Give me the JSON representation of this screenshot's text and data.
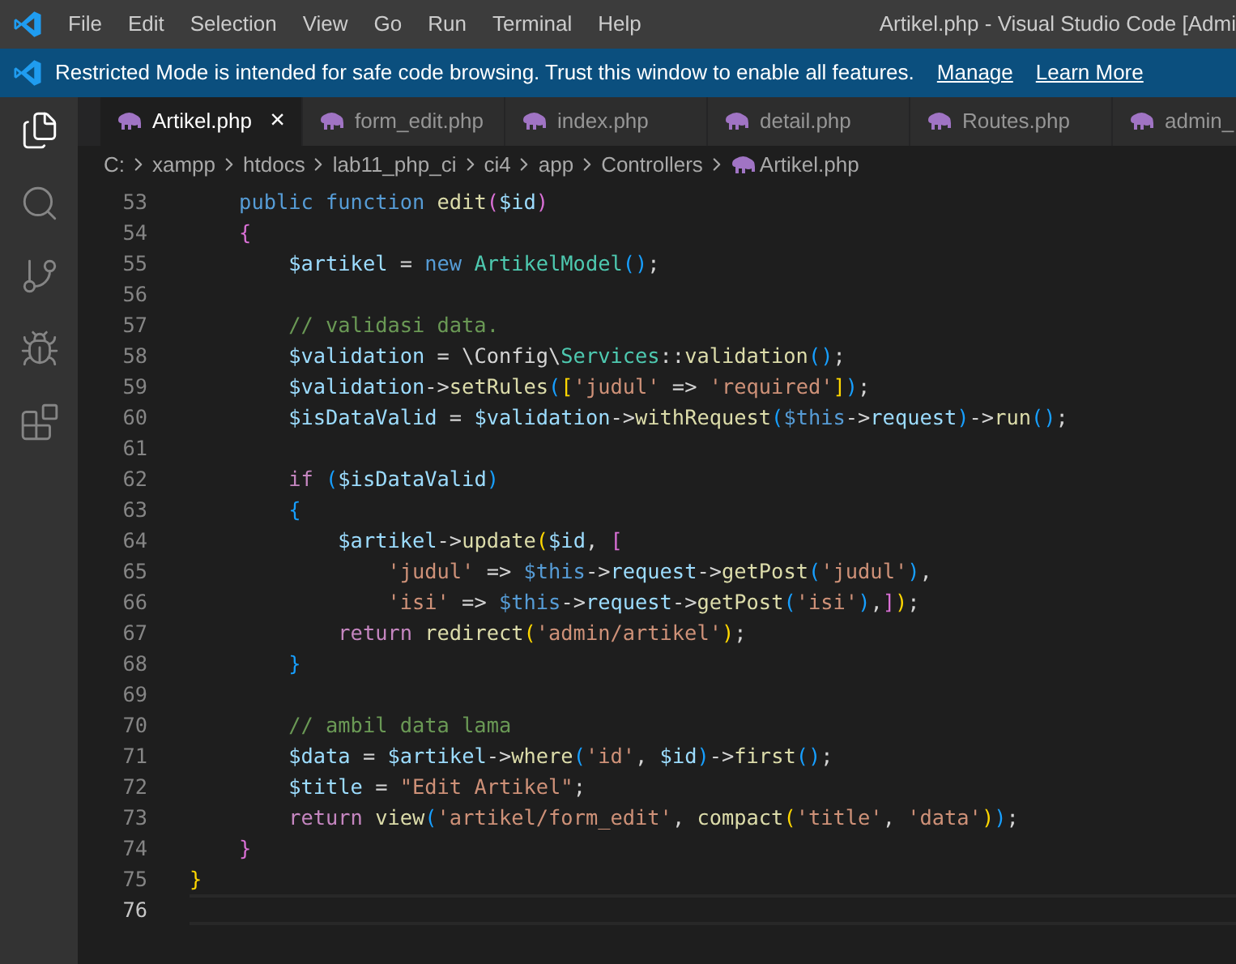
{
  "menu": [
    "File",
    "Edit",
    "Selection",
    "View",
    "Go",
    "Run",
    "Terminal",
    "Help"
  ],
  "window": {
    "title": "Artikel.php - Visual Studio Code [Admi"
  },
  "banner": {
    "text": "Restricted Mode is intended for safe code browsing. Trust this window to enable all features.",
    "links": [
      "Manage",
      "Learn More"
    ]
  },
  "activity_bar": [
    {
      "kind": "files",
      "selected": true
    },
    {
      "kind": "search",
      "selected": false
    },
    {
      "kind": "git",
      "selected": false
    },
    {
      "kind": "debug",
      "selected": false
    },
    {
      "kind": "extensions",
      "selected": false
    }
  ],
  "tabs": [
    {
      "label": "Artikel.php",
      "selected": true,
      "close": "×"
    },
    {
      "label": "form_edit.php",
      "selected": false
    },
    {
      "label": "index.php",
      "selected": false
    },
    {
      "label": "detail.php",
      "selected": false
    },
    {
      "label": "Routes.php",
      "selected": false
    },
    {
      "label": "admin_",
      "selected": false
    }
  ],
  "breadcrumbs": [
    "C:",
    "xampp",
    "htdocs",
    "lab11_php_ci",
    "ci4",
    "app",
    "Controllers",
    "Artikel.php"
  ],
  "editor": {
    "lines": [
      {
        "number": "53",
        "current": false,
        "tokens": [
          {
            "kind": "kw",
            "text": "    public"
          },
          {
            "kind": "kw",
            "text": " function"
          },
          {
            "kind": "fn",
            "text": " edit"
          },
          {
            "kind": "p",
            "text": "("
          },
          {
            "kind": "var",
            "text": "$id"
          },
          {
            "kind": "p",
            "text": ")"
          }
        ]
      },
      {
        "number": "54",
        "current": false,
        "tokens": [
          {
            "kind": "p",
            "text": "    {"
          }
        ]
      },
      {
        "number": "55",
        "current": false,
        "tokens": [
          {
            "kind": "var",
            "text": "        $artikel"
          },
          {
            "kind": "op",
            "text": " ="
          },
          {
            "kind": "kw",
            "text": " new"
          },
          {
            "kind": "cls",
            "text": " ArtikelModel"
          },
          {
            "kind": "b",
            "text": "()"
          },
          {
            "kind": "op",
            "text": ";"
          }
        ]
      },
      {
        "number": "56",
        "current": false
      },
      {
        "number": "57",
        "current": false,
        "tokens": [
          {
            "kind": "cm",
            "text": "        // validasi data."
          }
        ]
      },
      {
        "number": "58",
        "current": false,
        "tokens": [
          {
            "kind": "var",
            "text": "        $validation"
          },
          {
            "kind": "op",
            "text": " = \\Config\\"
          },
          {
            "kind": "cls",
            "text": "Services"
          },
          {
            "kind": "op",
            "text": "::"
          },
          {
            "kind": "fn",
            "text": "validation"
          },
          {
            "kind": "b",
            "text": "()"
          },
          {
            "kind": "op",
            "text": ";"
          }
        ]
      },
      {
        "number": "59",
        "current": false,
        "tokens": [
          {
            "kind": "var",
            "text": "        $validation"
          },
          {
            "kind": "op",
            "text": "->"
          },
          {
            "kind": "fn",
            "text": "setRules"
          },
          {
            "kind": "b",
            "text": "("
          },
          {
            "kind": "y",
            "text": "["
          },
          {
            "kind": "str",
            "text": "'judul'"
          },
          {
            "kind": "op",
            "text": " =>"
          },
          {
            "kind": "str",
            "text": " 'required'"
          },
          {
            "kind": "y",
            "text": "]"
          },
          {
            "kind": "b",
            "text": ")"
          },
          {
            "kind": "op",
            "text": ";"
          }
        ]
      },
      {
        "number": "60",
        "current": false,
        "tokens": [
          {
            "kind": "var",
            "text": "        $isDataValid"
          },
          {
            "kind": "op",
            "text": " ="
          },
          {
            "kind": "var",
            "text": " $validation"
          },
          {
            "kind": "op",
            "text": "->"
          },
          {
            "kind": "fn",
            "text": "withRequest"
          },
          {
            "kind": "b",
            "text": "("
          },
          {
            "kind": "kw",
            "text": "$this"
          },
          {
            "kind": "op",
            "text": "->"
          },
          {
            "kind": "var",
            "text": "request"
          },
          {
            "kind": "b",
            "text": ")"
          },
          {
            "kind": "op",
            "text": "->"
          },
          {
            "kind": "fn",
            "text": "run"
          },
          {
            "kind": "b",
            "text": "()"
          },
          {
            "kind": "op",
            "text": ";"
          }
        ]
      },
      {
        "number": "61",
        "current": false
      },
      {
        "number": "62",
        "current": false,
        "tokens": [
          {
            "kind": "ctl",
            "text": "        if"
          },
          {
            "kind": "b",
            "text": " ("
          },
          {
            "kind": "var",
            "text": "$isDataValid"
          },
          {
            "kind": "b",
            "text": ")"
          }
        ]
      },
      {
        "number": "63",
        "current": false,
        "tokens": [
          {
            "kind": "b",
            "text": "        {"
          }
        ]
      },
      {
        "number": "64",
        "current": false,
        "tokens": [
          {
            "kind": "var",
            "text": "            $artikel"
          },
          {
            "kind": "op",
            "text": "->"
          },
          {
            "kind": "fn",
            "text": "update"
          },
          {
            "kind": "y",
            "text": "("
          },
          {
            "kind": "var",
            "text": "$id"
          },
          {
            "kind": "op",
            "text": ","
          },
          {
            "kind": "p",
            "text": " ["
          }
        ]
      },
      {
        "number": "65",
        "current": false,
        "tokens": [
          {
            "kind": "str",
            "text": "                'judul'"
          },
          {
            "kind": "op",
            "text": " =>"
          },
          {
            "kind": "kw",
            "text": " $this"
          },
          {
            "kind": "op",
            "text": "->"
          },
          {
            "kind": "var",
            "text": "request"
          },
          {
            "kind": "op",
            "text": "->"
          },
          {
            "kind": "fn",
            "text": "getPost"
          },
          {
            "kind": "b",
            "text": "("
          },
          {
            "kind": "str",
            "text": "'judul'"
          },
          {
            "kind": "b",
            "text": ")"
          },
          {
            "kind": "op",
            "text": ","
          }
        ]
      },
      {
        "number": "66",
        "current": false,
        "tokens": [
          {
            "kind": "str",
            "text": "                'isi'"
          },
          {
            "kind": "op",
            "text": " =>"
          },
          {
            "kind": "kw",
            "text": " $this"
          },
          {
            "kind": "op",
            "text": "->"
          },
          {
            "kind": "var",
            "text": "request"
          },
          {
            "kind": "op",
            "text": "->"
          },
          {
            "kind": "fn",
            "text": "getPost"
          },
          {
            "kind": "b",
            "text": "("
          },
          {
            "kind": "str",
            "text": "'isi'"
          },
          {
            "kind": "b",
            "text": ")"
          },
          {
            "kind": "op",
            "text": ","
          },
          {
            "kind": "p",
            "text": "]"
          },
          {
            "kind": "y",
            "text": ")"
          },
          {
            "kind": "op",
            "text": ";"
          }
        ]
      },
      {
        "number": "67",
        "current": false,
        "tokens": [
          {
            "kind": "ctl",
            "text": "            return"
          },
          {
            "kind": "fn",
            "text": " redirect"
          },
          {
            "kind": "y",
            "text": "("
          },
          {
            "kind": "str",
            "text": "'admin/artikel'"
          },
          {
            "kind": "y",
            "text": ")"
          },
          {
            "kind": "op",
            "text": ";"
          }
        ]
      },
      {
        "number": "68",
        "current": false,
        "tokens": [
          {
            "kind": "b",
            "text": "        }"
          }
        ]
      },
      {
        "number": "69",
        "current": false
      },
      {
        "number": "70",
        "current": false,
        "tokens": [
          {
            "kind": "cm",
            "text": "        // ambil data lama"
          }
        ]
      },
      {
        "number": "71",
        "current": false,
        "tokens": [
          {
            "kind": "var",
            "text": "        $data"
          },
          {
            "kind": "op",
            "text": " ="
          },
          {
            "kind": "var",
            "text": " $artikel"
          },
          {
            "kind": "op",
            "text": "->"
          },
          {
            "kind": "fn",
            "text": "where"
          },
          {
            "kind": "b",
            "text": "("
          },
          {
            "kind": "str",
            "text": "'id'"
          },
          {
            "kind": "op",
            "text": ","
          },
          {
            "kind": "var",
            "text": " $id"
          },
          {
            "kind": "b",
            "text": ")"
          },
          {
            "kind": "op",
            "text": "->"
          },
          {
            "kind": "fn",
            "text": "first"
          },
          {
            "kind": "b",
            "text": "()"
          },
          {
            "kind": "op",
            "text": ";"
          }
        ]
      },
      {
        "number": "72",
        "current": false,
        "tokens": [
          {
            "kind": "var",
            "text": "        $title"
          },
          {
            "kind": "op",
            "text": " ="
          },
          {
            "kind": "str",
            "text": " \"Edit Artikel\""
          },
          {
            "kind": "op",
            "text": ";"
          }
        ]
      },
      {
        "number": "73",
        "current": false,
        "tokens": [
          {
            "kind": "ctl",
            "text": "        return"
          },
          {
            "kind": "fn",
            "text": " view"
          },
          {
            "kind": "b",
            "text": "("
          },
          {
            "kind": "str",
            "text": "'artikel/form_edit'"
          },
          {
            "kind": "op",
            "text": ","
          },
          {
            "kind": "fn",
            "text": " compact"
          },
          {
            "kind": "y",
            "text": "("
          },
          {
            "kind": "str",
            "text": "'title'"
          },
          {
            "kind": "op",
            "text": ","
          },
          {
            "kind": "str",
            "text": " 'data'"
          },
          {
            "kind": "y",
            "text": ")"
          },
          {
            "kind": "b",
            "text": ")"
          },
          {
            "kind": "op",
            "text": ";"
          }
        ]
      },
      {
        "number": "74",
        "current": false,
        "tokens": [
          {
            "kind": "p",
            "text": "    }"
          }
        ]
      },
      {
        "number": "75",
        "current": false,
        "tokens": [
          {
            "kind": "y",
            "text": "}"
          }
        ]
      },
      {
        "number": "76",
        "current": true
      }
    ]
  }
}
